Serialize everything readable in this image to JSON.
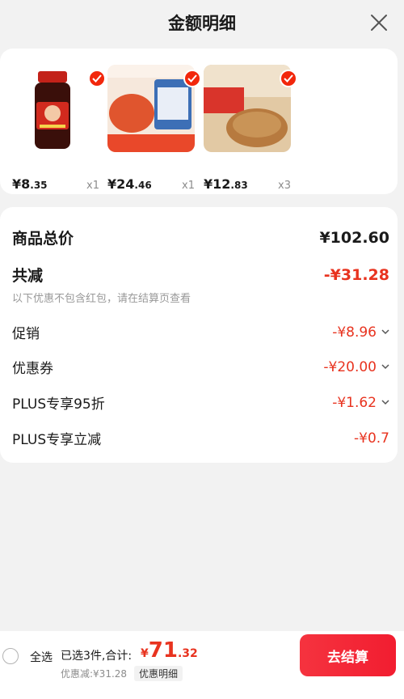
{
  "header": {
    "title": "金额明细"
  },
  "products": [
    {
      "price_int": "¥8",
      "price_dec": ".35",
      "qty": "x1",
      "color": "#8a1c12"
    },
    {
      "price_int": "¥24",
      "price_dec": ".46",
      "qty": "x1",
      "color": "#e85d3a"
    },
    {
      "price_int": "¥12",
      "price_dec": ".83",
      "qty": "x3",
      "color": "#c58a4c"
    }
  ],
  "summary": {
    "total_label": "商品总价",
    "total_value": "¥102.60",
    "reduce_label": "共减",
    "reduce_value": "-¥31.28",
    "note": "以下优惠不包含红包，请在结算页查看",
    "items": [
      {
        "label": "促销",
        "value": "-¥8.96"
      },
      {
        "label": "优惠券",
        "value": "-¥20.00"
      },
      {
        "label": "PLUS专享95折",
        "value": "-¥1.62"
      },
      {
        "label": "PLUS专享立减",
        "value": "-¥0.7"
      }
    ]
  },
  "footer": {
    "select_all": "全选",
    "selected_info": "已选3件,合计:",
    "total_currency": "¥",
    "total_int": "71",
    "total_dec": ".32",
    "discount": "优惠减:¥31.28",
    "detail_button": "优惠明细",
    "checkout": "去结算"
  },
  "colors": {
    "accent": "#e8331f",
    "checkout": "#f2273a"
  }
}
